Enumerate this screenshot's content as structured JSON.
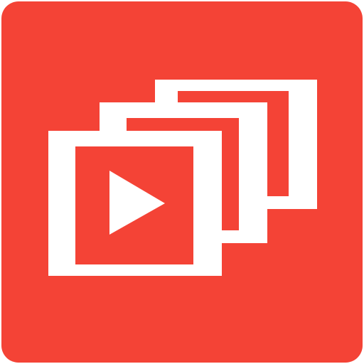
{
  "icon": {
    "name": "video-playlist-icon",
    "colors": {
      "background": "#F44336",
      "frames": "#FFFFFF",
      "inner": "#F44336",
      "play": "#FFFFFF"
    }
  }
}
